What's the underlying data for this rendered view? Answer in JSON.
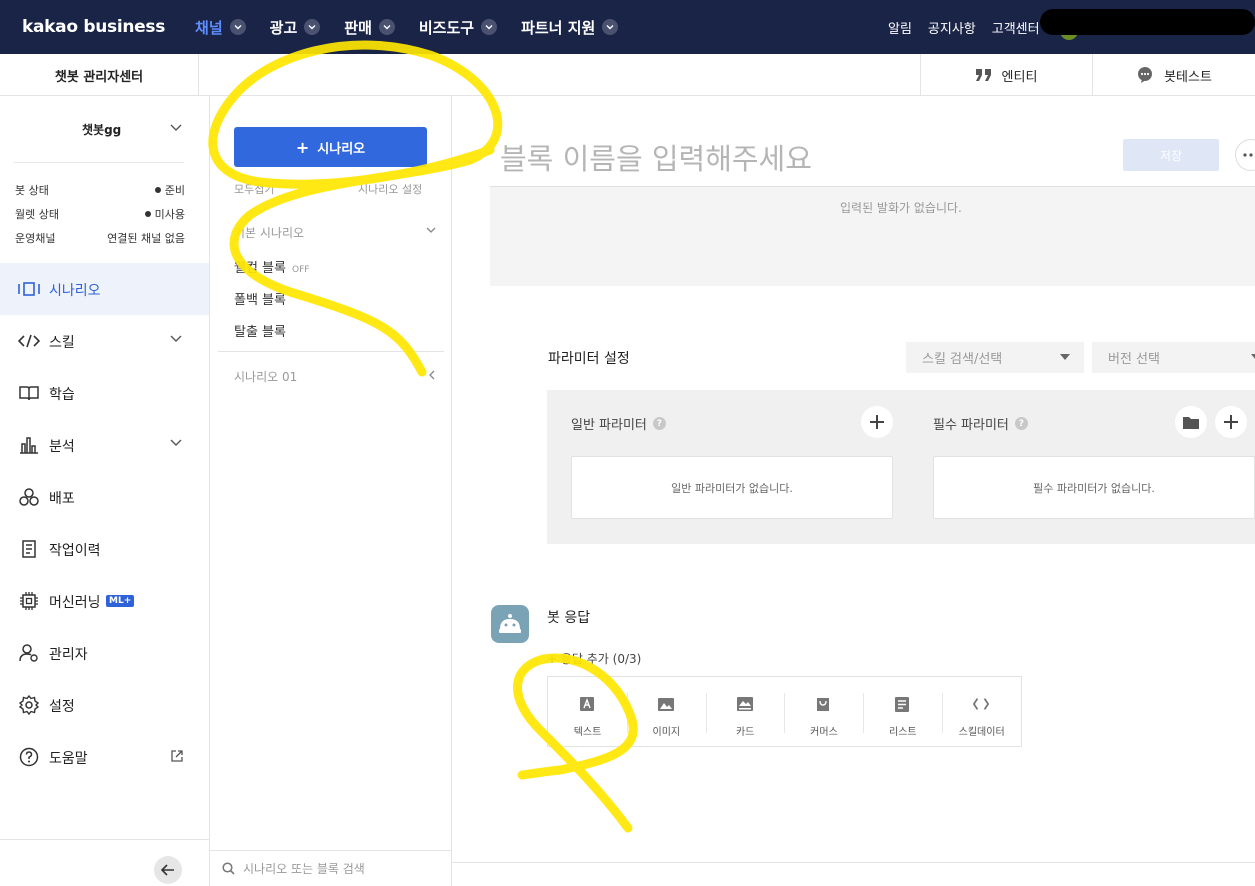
{
  "topnav": {
    "logo": "kakao business",
    "items": [
      {
        "label": "채널",
        "active": true
      },
      {
        "label": "광고",
        "active": false
      },
      {
        "label": "판매",
        "active": false
      },
      {
        "label": "비즈도구",
        "active": false
      },
      {
        "label": "파트너 지원",
        "active": false
      }
    ],
    "right": [
      "알림",
      "공지사항",
      "고객센터"
    ]
  },
  "header": {
    "brand": "챗봇 관리자센터",
    "entity_label": "엔티티",
    "bottest_label": "봇테스트"
  },
  "sidebar": {
    "bot_name": "챗봇gg",
    "status": [
      {
        "label": "봇 상태",
        "value": "준비",
        "dot": true
      },
      {
        "label": "월렛 상태",
        "value": "미사용",
        "dot": true
      },
      {
        "label": "운영채널",
        "value": "연결된 채널 없음",
        "dot": false
      }
    ],
    "menu": [
      {
        "label": "시나리오",
        "icon": "scenario-icon",
        "active": true
      },
      {
        "label": "스킬",
        "icon": "code-icon",
        "chevron": true
      },
      {
        "label": "학습",
        "icon": "book-icon"
      },
      {
        "label": "분석",
        "icon": "chart-icon",
        "chevron": true
      },
      {
        "label": "배포",
        "icon": "deploy-icon"
      },
      {
        "label": "작업이력",
        "icon": "history-icon"
      },
      {
        "label": "머신러닝",
        "icon": "chip-icon",
        "badge": "ML+"
      },
      {
        "label": "관리자",
        "icon": "admin-icon"
      },
      {
        "label": "설정",
        "icon": "gear-icon"
      },
      {
        "label": "도움말",
        "icon": "help-icon",
        "external": true
      }
    ]
  },
  "scenario_panel": {
    "add_button": "시나리오",
    "collapse_all": "모두접기",
    "settings": "시나리오 설정",
    "section_title": "기본 시나리오",
    "blocks": [
      {
        "label": "웰컴 블록",
        "badge": "OFF"
      },
      {
        "label": "폴백 블록"
      },
      {
        "label": "탈출 블록"
      }
    ],
    "scenario_01": "시나리오 01",
    "search_placeholder": "시나리오 또는 블록 검색"
  },
  "main": {
    "block_name_placeholder": "블록 이름을 입력해주세요",
    "save_label": "저장",
    "no_utterance": "입력된 발화가 없습니다.",
    "param_title": "파라미터 설정",
    "skill_select": "스킬 검색/선택",
    "version_select": "버전 선택",
    "general_param": "일반 파라미터",
    "required_param": "필수 파라미터",
    "no_general_param": "일반 파라미터가 없습니다.",
    "no_required_param": "필수 파라미터가 없습니다.",
    "bot_response": "봇 응답",
    "add_response": "+ 응답 추가 (0/3)",
    "response_types": [
      {
        "label": "텍스트",
        "icon": "text-icon"
      },
      {
        "label": "이미지",
        "icon": "image-icon"
      },
      {
        "label": "카드",
        "icon": "card-icon"
      },
      {
        "label": "커머스",
        "icon": "commerce-icon"
      },
      {
        "label": "리스트",
        "icon": "list-icon"
      },
      {
        "label": "스킬데이터",
        "icon": "skilldata-icon"
      }
    ]
  },
  "colors": {
    "nav_bg": "#1a2447",
    "accent": "#3168dd",
    "active_nav": "#5d8dff",
    "scribble": "#ffe600"
  }
}
